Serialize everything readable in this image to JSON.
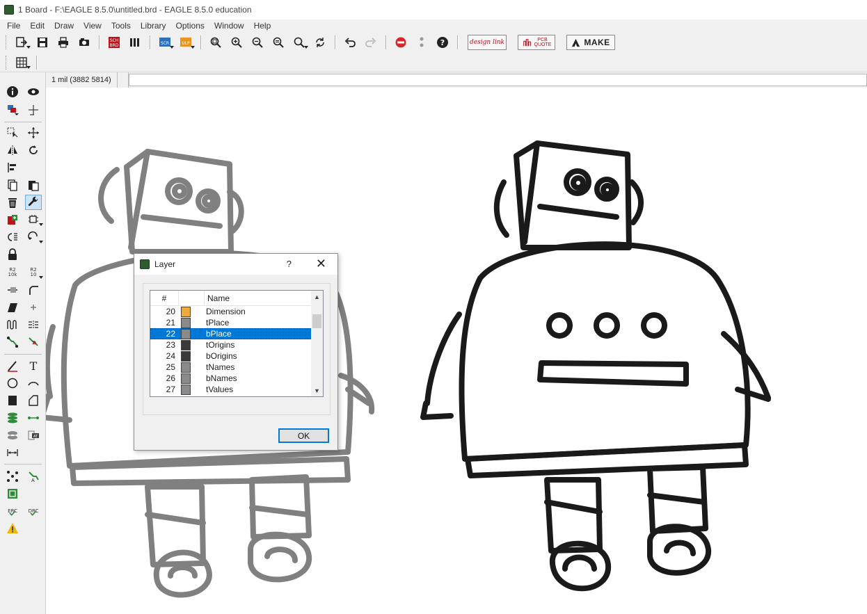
{
  "window": {
    "title": "1 Board - F:\\EAGLE 8.5.0\\untitled.brd - EAGLE 8.5.0 education"
  },
  "menu": [
    "File",
    "Edit",
    "Draw",
    "View",
    "Tools",
    "Library",
    "Options",
    "Window",
    "Help"
  ],
  "toolbar": {
    "design_link_label": "design link",
    "pcb_quote_label": "PCB QUOTE",
    "make_label": "MAKE",
    "sch_brd_label": "SCH BRD",
    "scr_label": "SCR",
    "ulp_label": "ULP"
  },
  "palette": {
    "r2_label": "R2 10k",
    "r2b_label": "R2 10",
    "erc_label": "ERC",
    "drc_label": "DRC",
    "at_label": "AT"
  },
  "coordinates": {
    "readout": "1 mil (3882 5814)",
    "command_value": ""
  },
  "layer_dialog": {
    "title": "Layer",
    "help_label": "?",
    "close_label": "✕",
    "col_num": "#",
    "col_name": "Name",
    "ok_label": "OK",
    "rows": [
      {
        "num": "20",
        "name": "Dimension",
        "color": "#f2a93b",
        "selected": false
      },
      {
        "num": "21",
        "name": "tPlace",
        "color": "#8a8a8a",
        "selected": false
      },
      {
        "num": "22",
        "name": "bPlace",
        "color": "#8a8a8a",
        "selected": true
      },
      {
        "num": "23",
        "name": "tOrigins",
        "color": "#3a3a3a",
        "selected": false
      },
      {
        "num": "24",
        "name": "bOrigins",
        "color": "#3a3a3a",
        "selected": false
      },
      {
        "num": "25",
        "name": "tNames",
        "color": "#8a8a8a",
        "selected": false
      },
      {
        "num": "26",
        "name": "bNames",
        "color": "#8a8a8a",
        "selected": false
      },
      {
        "num": "27",
        "name": "tValues",
        "color": "#8a8a8a",
        "selected": false
      }
    ]
  },
  "colors": {
    "selection": "#0078d7",
    "robot_bottom_layer": "#808080",
    "robot_top_layer": "#1a1a1a"
  }
}
